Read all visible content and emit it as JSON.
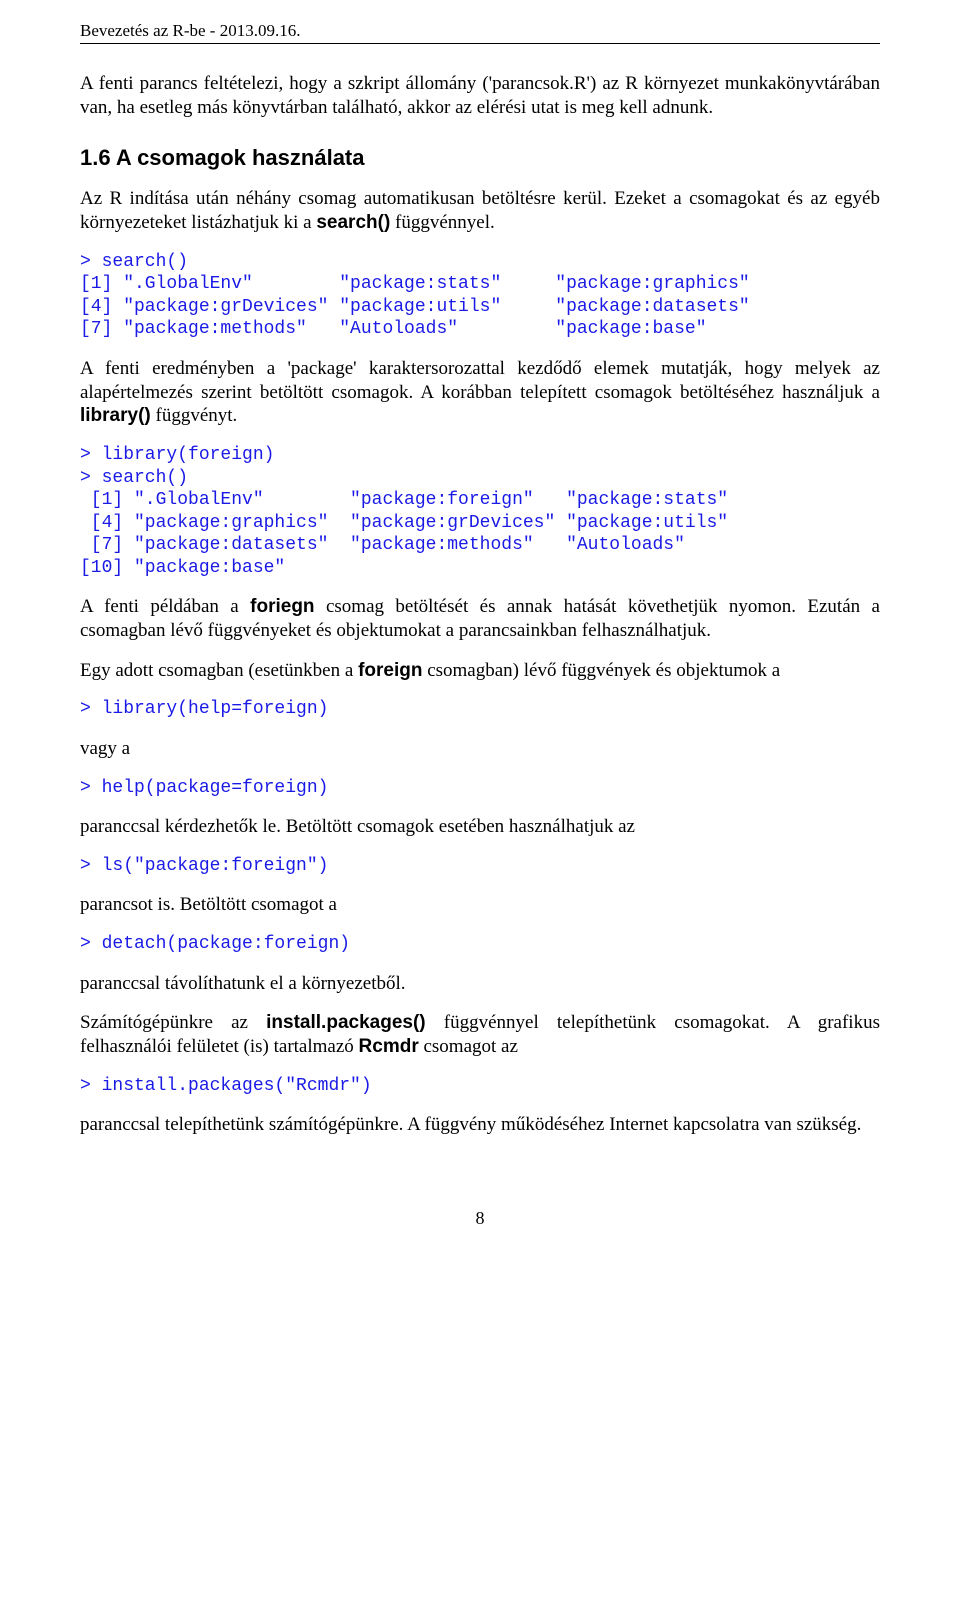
{
  "header": "Bevezetés az R-be - 2013.09.16.",
  "p1_a": "A fenti parancs feltételezi, hogy a szkript állomány (",
  "p1_b": "'parancsok.R'",
  "p1_c": ") az R környezet munkakönyvtárában van, ha esetleg más könyvtárban található, akkor az elérési utat is meg kell adnunk.",
  "h1": "1.6 A csomagok használata",
  "p2_a": "Az R indítása után néhány csomag automatikusan betöltésre kerül. Ezeket a csomagokat és az egyéb környezeteket listázhatjuk ki a ",
  "p2_b": "search()",
  "p2_c": " függvénnyel.",
  "code1": "> search()\n[1] \".GlobalEnv\"        \"package:stats\"     \"package:graphics\"\n[4] \"package:grDevices\" \"package:utils\"     \"package:datasets\"\n[7] \"package:methods\"   \"Autoloads\"         \"package:base\"",
  "p3_a": "A fenti eredményben a 'package' karaktersorozattal kezdődő elemek mutatják, hogy melyek az alapértelmezés szerint betöltött csomagok. A korábban telepített csomagok betöltéséhez használjuk a ",
  "p3_b": "library()",
  "p3_c": " függvényt.",
  "code2": "> library(foreign)\n> search()\n [1] \".GlobalEnv\"        \"package:foreign\"   \"package:stats\"\n [4] \"package:graphics\"  \"package:grDevices\" \"package:utils\"\n [7] \"package:datasets\"  \"package:methods\"   \"Autoloads\"\n[10] \"package:base\"",
  "p4_a": "A fenti példában a ",
  "p4_b": "foriegn",
  "p4_c": " csomag betöltését és annak hatását követhetjük nyomon. Ezután a csomagban lévő függvényeket és objektumokat a parancsainkban felhasználhatjuk.",
  "p5_a": "Egy adott csomagban (esetünkben a ",
  "p5_b": "foreign",
  "p5_c": " csomagban) lévő függvények és objektumok a",
  "code3": "> library(help=foreign)",
  "p6": "vagy a",
  "code4": "> help(package=foreign)",
  "p7": "paranccsal kérdezhetők le. Betöltött csomagok esetében használhatjuk az",
  "code5": "> ls(\"package:foreign\")",
  "p8": "parancsot is. Betöltött csomagot a",
  "code6": "> detach(package:foreign)",
  "p9": "paranccsal távolíthatunk el a környezetből.",
  "p10_a": "Számítógépünkre az ",
  "p10_b": "install.packages()",
  "p10_c": " függvénnyel telepíthetünk csomagokat. A grafikus felhasználói felületet (is) tartalmazó ",
  "p10_d": "Rcmdr",
  "p10_e": " csomagot az",
  "code7": "> install.packages(\"Rcmdr\")",
  "p11": "paranccsal telepíthetünk számítógépünkre. A függvény működéséhez Internet kapcsolatra van szükség.",
  "pagenum": "8"
}
